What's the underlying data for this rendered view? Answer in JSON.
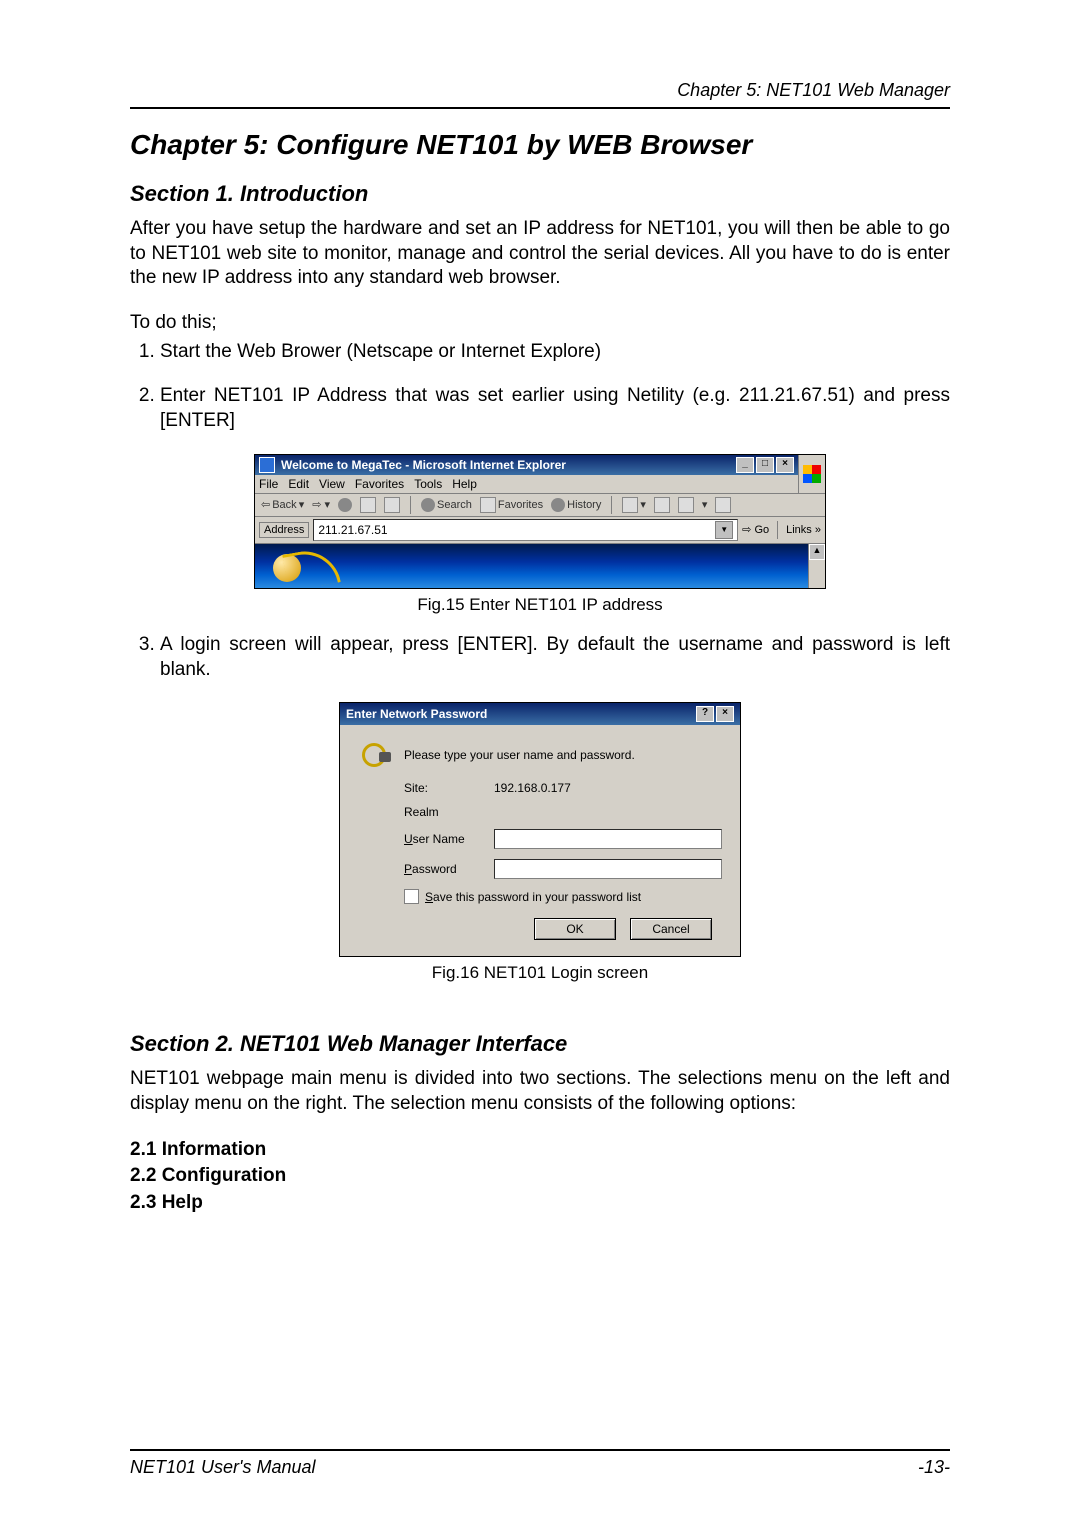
{
  "header": {
    "chapter_label": "Chapter 5: NET101 Web Manager"
  },
  "title": "Chapter 5: Configure NET101 by WEB Browser",
  "section1": {
    "title": "Section 1. Introduction",
    "intro": "After you have setup the hardware and set an IP address for NET101, you will then be able to go to NET101 web site to monitor, manage and control the serial devices. All you have to do is enter the new IP address into any standard web browser.",
    "lead": "To do this;",
    "steps": {
      "s1": "Start the Web Brower (Netscape or Internet Explore)",
      "s2": "Enter NET101 IP Address that was set earlier using Netility (e.g. 211.21.67.51) and press [ENTER]",
      "s3": "A login screen will appear, press [ENTER]. By default the username and password is left blank."
    }
  },
  "fig15": {
    "caption": "Fig.15  Enter NET101 IP address"
  },
  "ie": {
    "title": "Welcome to MegaTec - Microsoft Internet Explorer",
    "menu": {
      "file": "File",
      "edit": "Edit",
      "view": "View",
      "favorites": "Favorites",
      "tools": "Tools",
      "help": "Help"
    },
    "toolbar": {
      "back": "Back",
      "search": "Search",
      "favorites": "Favorites",
      "history": "History"
    },
    "address_label": "Address",
    "url": "211.21.67.51",
    "go": "Go",
    "links": "Links"
  },
  "dlg": {
    "title": "Enter Network Password",
    "prompt": "Please type your user name and password.",
    "site_label": "Site:",
    "site_value": "192.168.0.177",
    "realm_label": "Realm",
    "user_pre": "U",
    "user_rest": "ser Name",
    "pass_pre": "P",
    "pass_rest": "assword",
    "save_pre": "S",
    "save_rest": "ave this password in your password list",
    "ok": "OK",
    "cancel": "Cancel"
  },
  "fig16": {
    "caption": "Fig.16  NET101 Login screen"
  },
  "section2": {
    "title": "Section 2. NET101 Web Manager Interface",
    "para": "NET101 webpage main menu is divided into two sections. The selections menu on the left and display menu on the right. The selection menu consists of the following options:",
    "items": {
      "i1": "2.1 Information",
      "i2": "2.2 Configuration",
      "i3": "2.3 Help"
    }
  },
  "footer": {
    "left": "NET101  User's  Manual",
    "right": "-13-"
  }
}
